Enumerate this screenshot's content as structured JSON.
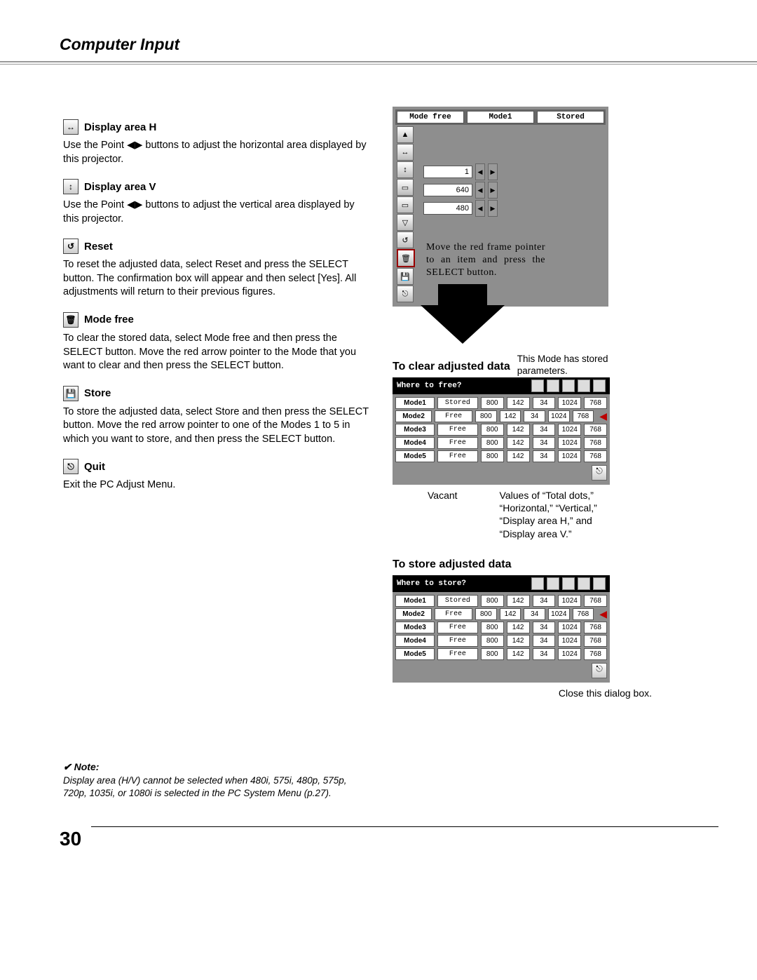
{
  "header_title": "Computer Input",
  "page_number": "30",
  "sections": [
    {
      "title": "Display area H",
      "icon": "↔",
      "body": "Use the Point ◀▶ buttons to adjust the horizontal area displayed by this projector."
    },
    {
      "title": "Display area V",
      "icon": "↕",
      "body": "Use the Point ◀▶ buttons to adjust the vertical area displayed by this projector."
    },
    {
      "title": "Reset",
      "icon": "↺",
      "body": "To reset the adjusted data, select Reset and press the SELECT button.  The confirmation box will appear and then select [Yes].  All adjustments will return to their previous figures."
    },
    {
      "title": "Mode free",
      "icon": "🗑",
      "body": "To clear the stored data, select Mode free and then press the SELECT button. Move the red arrow pointer to the Mode that you want to clear and then press the SELECT button."
    },
    {
      "title": "Store",
      "icon": "💾",
      "body": "To store the adjusted data, select Store and then press the SELECT button. Move the red arrow pointer to one of the Modes 1 to 5 in which you want to store, and then press the SELECT button."
    },
    {
      "title": "Quit",
      "icon": "⎋",
      "body": "Exit the PC Adjust Menu."
    }
  ],
  "top_dialog": {
    "tabs": [
      "Mode free",
      "Mode1",
      "Stored"
    ],
    "rows": [
      {
        "value": "1"
      },
      {
        "value": "640"
      },
      {
        "value": "480"
      }
    ],
    "callout": "Move the red frame pointer to an item and press the SELECT button."
  },
  "clear_heading": "To clear adjusted data",
  "clear_side_note": "This Mode has stored parameters.",
  "clear_dialog": {
    "title": "Where to free?",
    "rows": [
      {
        "mode": "Mode1",
        "stat": "Stored",
        "v": [
          "800",
          "142",
          "34",
          "1024",
          "768"
        ]
      },
      {
        "mode": "Mode2",
        "stat": "Free",
        "v": [
          "800",
          "142",
          "34",
          "1024",
          "768"
        ]
      },
      {
        "mode": "Mode3",
        "stat": "Free",
        "v": [
          "800",
          "142",
          "34",
          "1024",
          "768"
        ]
      },
      {
        "mode": "Mode4",
        "stat": "Free",
        "v": [
          "800",
          "142",
          "34",
          "1024",
          "768"
        ]
      },
      {
        "mode": "Mode5",
        "stat": "Free",
        "v": [
          "800",
          "142",
          "34",
          "1024",
          "768"
        ]
      }
    ]
  },
  "clear_ann_left": "Vacant",
  "clear_ann_right": "Values of “Total dots,” “Horizontal,” “Vertical,” “Display area H,” and “Display area V.”",
  "store_heading": "To store adjusted data",
  "store_dialog": {
    "title": "Where to store?",
    "rows": [
      {
        "mode": "Mode1",
        "stat": "Stored",
        "v": [
          "800",
          "142",
          "34",
          "1024",
          "768"
        ]
      },
      {
        "mode": "Mode2",
        "stat": "Free",
        "v": [
          "800",
          "142",
          "34",
          "1024",
          "768"
        ]
      },
      {
        "mode": "Mode3",
        "stat": "Free",
        "v": [
          "800",
          "142",
          "34",
          "1024",
          "768"
        ]
      },
      {
        "mode": "Mode4",
        "stat": "Free",
        "v": [
          "800",
          "142",
          "34",
          "1024",
          "768"
        ]
      },
      {
        "mode": "Mode5",
        "stat": "Free",
        "v": [
          "800",
          "142",
          "34",
          "1024",
          "768"
        ]
      }
    ]
  },
  "store_ann": "Close this dialog box.",
  "note_heading": "Note:",
  "note_body": "Display area (H/V) cannot be selected when 480i, 575i, 480p, 575p, 720p, 1035i, or 1080i is selected in the PC System Menu (p.27)."
}
